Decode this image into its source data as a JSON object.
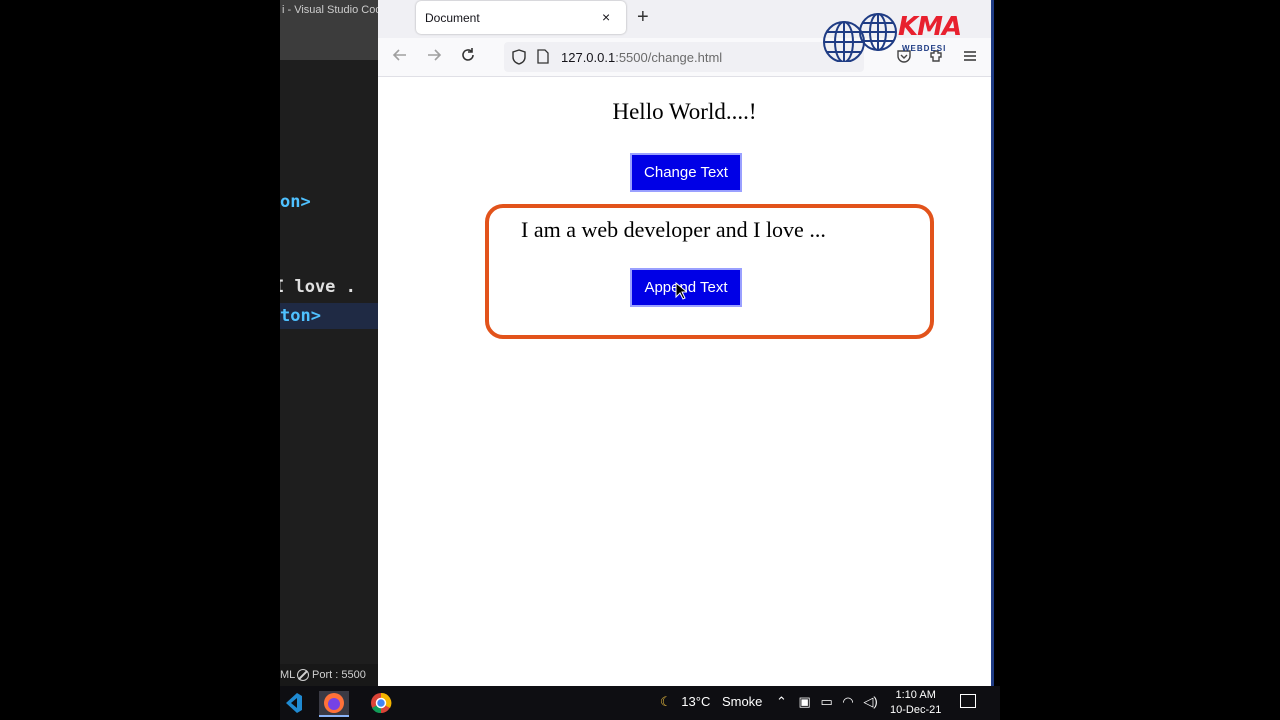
{
  "vscode": {
    "title": "i - Visual Studio Code",
    "code_lines": [
      {
        "text": "on>",
        "color": "#4fc1ff"
      },
      {
        "text": " I love .",
        "color": "#e0e0e0"
      },
      {
        "text": "ton>",
        "color": "#4fc1ff"
      }
    ],
    "status_lang": "ML",
    "status_port": "Port : 5500"
  },
  "browser": {
    "tab_title": "Document",
    "tab_close": "×",
    "new_tab": "+",
    "url_host": "127.0.0.1",
    "url_path": ":5500/change.html"
  },
  "logo": {
    "text": "KMA",
    "sub": "WEBDESI"
  },
  "page": {
    "heading": "Hello World....!",
    "change_button": "Change Text",
    "paragraph": "I am a web developer and I love ...",
    "append_button": "Append Text",
    "highlight_color": "#e2531b",
    "button_color": "#0000e6"
  },
  "taskbar": {
    "weather_temp": "13°C",
    "weather_desc": "Smoke",
    "time": "1:10 AM",
    "date": "10-Dec-21"
  }
}
